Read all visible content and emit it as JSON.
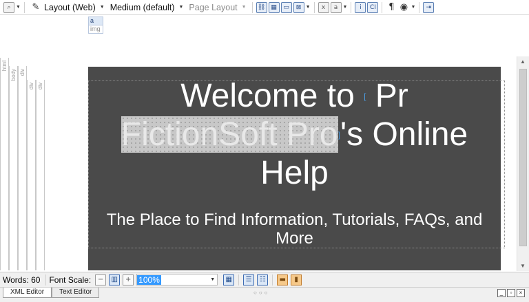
{
  "toolbar": {
    "layout_label": "Layout (Web)",
    "size_label": "Medium (default)",
    "page_layout_label": "Page Layout",
    "pilcrow": "¶",
    "icon_a": "a",
    "icon_i": "i",
    "icon_ci": "CI"
  },
  "tag_crumb": {
    "first": "a",
    "second": "img"
  },
  "gutter_tags": [
    "html",
    "body",
    "div",
    "div",
    "div"
  ],
  "document": {
    "title_part1": "Welcome to ",
    "title_part2": " Pr",
    "title_highlight": "FictionSoft Pro",
    "title_part3": "'s Online",
    "title_line3": "Help",
    "subtitle_line1": "The Place to Find Information, Tutorials, FAQs, and",
    "subtitle_line2": "More"
  },
  "status": {
    "words": "Words: 60",
    "font_scale_label": "Font Scale:",
    "zoom_value": "100%"
  },
  "tabs": [
    {
      "label": "XML Editor",
      "active": true
    },
    {
      "label": "Text Editor",
      "active": false
    }
  ],
  "colors": {
    "page_bg": "#4a4a4a",
    "highlight": "#c8c8c8",
    "accent": "#3399ff"
  }
}
